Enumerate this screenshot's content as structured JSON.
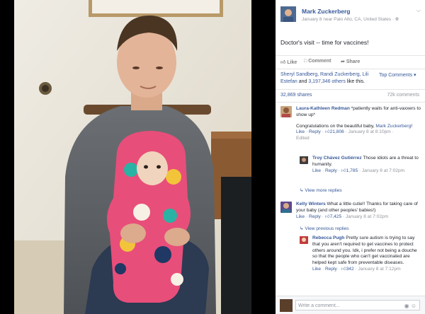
{
  "post": {
    "author": "Mark Zuckerberg",
    "meta": "January 8 near Palo Alto, CA, United States ·",
    "text": "Doctor's visit -- time for vaccines!",
    "actions": {
      "like": "Like",
      "comment": "Comment",
      "share": "Share"
    },
    "likes_names": "Sheryl Sandberg, Randi Zuckerberg, Lili Estefan",
    "likes_mid": " and ",
    "likes_others": "3,197,346 others",
    "likes_tail": " like this.",
    "top_comments": "Top Comments ▾",
    "shares": "32,869 shares",
    "comment_count": "72k comments"
  },
  "comments": [
    {
      "name": "Laura-Kathleen Redman",
      "text": " *patiently waits for anti-vaxxers to show up*",
      "text2a": "Congratulations on the beautiful baby, ",
      "text2_link": "Mark Zuckerberg",
      "text2b": "!",
      "like": "Like",
      "reply": "Reply",
      "count": "21,806",
      "time": "January 8 at 8:10pm",
      "edited": "Edited"
    },
    {
      "name": "Troy Chávez Gutiérrez",
      "text": " Those idiots are a threat to humanity.",
      "like": "Like",
      "reply": "Reply",
      "count": "1,785",
      "time": "January 8 at 7:02pm"
    },
    {
      "name": "Kelly Winters",
      "text": " What a little cutie!! Thanks for taking care of your baby (and other peoples' babies!)",
      "like": "Like",
      "reply": "Reply",
      "count": "7,425",
      "time": "January 8 at 7:02pm"
    },
    {
      "name": "Rebecca Pugh",
      "text": " Pretty sure autism is trying to say that you aren't required to get vaccines to protect others around you. Idk, i prefer not being a douche so that the people who can't get vaccinated are helped kept safe from preventable diseases.",
      "like": "Like",
      "reply": "Reply",
      "count": "342",
      "time": "January 8 at 7:12pm"
    }
  ],
  "view_more_replies": "View more replies",
  "view_previous_replies": "View previous replies",
  "write_comment": "Write a comment...",
  "colors": {
    "link": "#365899",
    "meta": "#90949c",
    "text": "#1d2129"
  }
}
